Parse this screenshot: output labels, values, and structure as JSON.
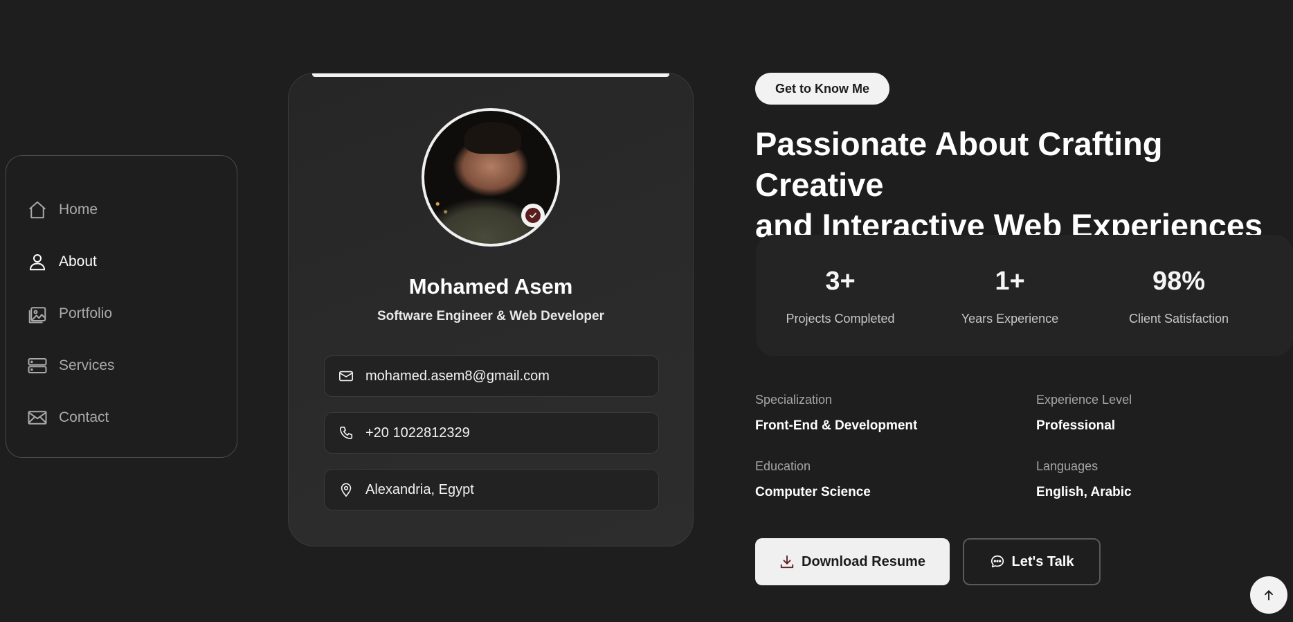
{
  "sidebar": {
    "items": [
      {
        "label": "Home",
        "icon": "home-icon"
      },
      {
        "label": "About",
        "icon": "user-icon",
        "active": true
      },
      {
        "label": "Portfolio",
        "icon": "image-icon"
      },
      {
        "label": "Services",
        "icon": "server-icon"
      },
      {
        "label": "Contact",
        "icon": "mail-icon"
      }
    ]
  },
  "profile": {
    "name": "Mohamed Asem",
    "role": "Software Engineer & Web Developer",
    "avatar_alt": "profile photo",
    "email": "mohamed.asem8@gmail.com",
    "phone": "+20 1022812329",
    "location": "Alexandria, Egypt"
  },
  "about": {
    "badge": "Get to Know Me",
    "headline_line1": "Passionate About Crafting Creative",
    "headline_line2": "and Interactive Web Experiences",
    "stats": [
      {
        "value": "3+",
        "label": "Projects Completed"
      },
      {
        "value": "1+",
        "label": "Years Experience"
      },
      {
        "value": "98%",
        "label": "Client Satisfaction"
      }
    ],
    "details": [
      {
        "key": "Specialization",
        "value": "Front-End & Development"
      },
      {
        "key": "Experience Level",
        "value": "Professional"
      },
      {
        "key": "Education",
        "value": "Computer Science"
      },
      {
        "key": "Languages",
        "value": "English, Arabic"
      }
    ],
    "download_label": "Download Resume",
    "talk_label": "Let's Talk"
  },
  "colors": {
    "background": "#1e1e1e",
    "card": "#2a2a2a",
    "accent": "#f2f2f2",
    "badge_dark": "#5a1d1d"
  }
}
